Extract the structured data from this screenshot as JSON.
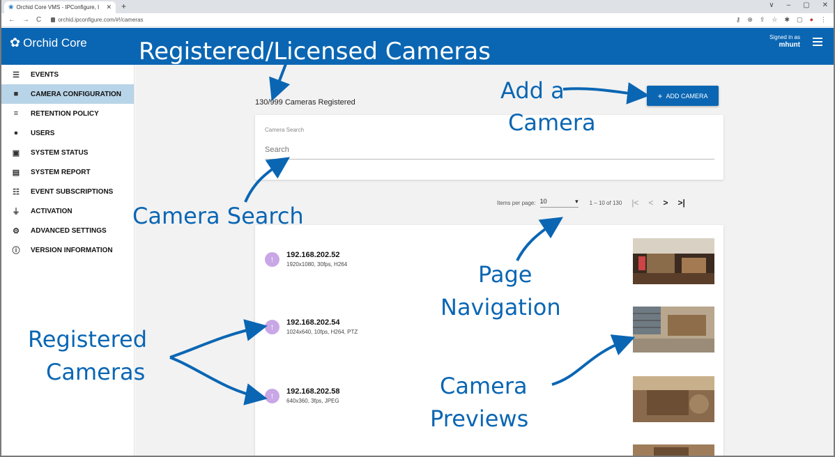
{
  "browser": {
    "tab_title": "Orchid Core VMS - IPConfigure, I",
    "tab_close": "✕",
    "new_tab": "+",
    "url": "orchid.ipconfigure.com/#!/cameras",
    "window_controls": [
      "∨",
      "–",
      "▢",
      "✕"
    ]
  },
  "app": {
    "logo_text": "Orchid Core",
    "signed_in_label": "Signed in as",
    "username": "mhunt"
  },
  "sidebar": {
    "items": [
      {
        "label": "EVENTS",
        "icon": "events-icon"
      },
      {
        "label": "CAMERA CONFIGURATION",
        "icon": "camera-icon",
        "active": true
      },
      {
        "label": "RETENTION POLICY",
        "icon": "database-icon"
      },
      {
        "label": "USERS",
        "icon": "user-icon"
      },
      {
        "label": "SYSTEM STATUS",
        "icon": "status-icon"
      },
      {
        "label": "SYSTEM REPORT",
        "icon": "report-icon"
      },
      {
        "label": "EVENT SUBSCRIPTIONS",
        "icon": "subscriptions-icon"
      },
      {
        "label": "ACTIVATION",
        "icon": "plug-icon"
      },
      {
        "label": "ADVANCED SETTINGS",
        "icon": "gears-icon"
      },
      {
        "label": "VERSION INFORMATION",
        "icon": "info-icon"
      }
    ]
  },
  "main": {
    "registered_count": "130/999 Cameras Registered",
    "add_camera_label": "ADD CAMERA",
    "search": {
      "label": "Camera Search",
      "placeholder": "Search"
    },
    "pager": {
      "items_per_page_label": "Items per page:",
      "items_per_page_value": "10",
      "range": "1 – 10 of 130"
    },
    "cameras": [
      {
        "ip": "192.168.202.52",
        "spec": "1920x1080, 30fps, H264"
      },
      {
        "ip": "192.168.202.54",
        "spec": "1024x640, 10fps, H264, PTZ"
      },
      {
        "ip": "192.168.202.58",
        "spec": "640x360, 3fps, JPEG"
      }
    ]
  },
  "annotations": {
    "registered_licensed": "Registered/Licensed Cameras",
    "add_a_camera_1": "Add a",
    "add_a_camera_2": "Camera",
    "camera_search": "Camera Search",
    "page_navigation_1": "Page",
    "page_navigation_2": "Navigation",
    "registered_cameras_1": "Registered",
    "registered_cameras_2": "Cameras",
    "camera_previews_1": "Camera",
    "camera_previews_2": "Previews"
  },
  "colors": {
    "brand_blue": "#0a66b3",
    "active_nav": "#b8d4e8",
    "camera_icon": "#c9a7e6"
  }
}
